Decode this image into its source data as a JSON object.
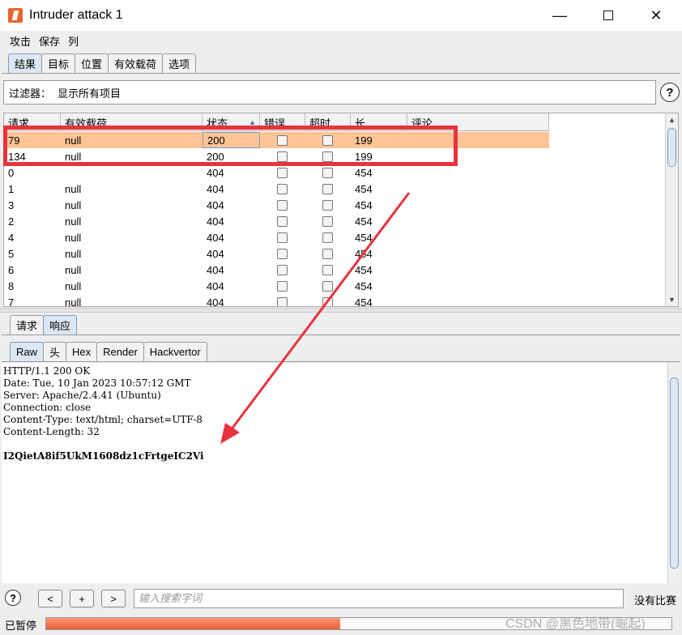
{
  "window": {
    "title": "Intruder attack 1",
    "minimize": "—",
    "close": "✕"
  },
  "menu": [
    "攻击",
    "保存",
    "列"
  ],
  "main_tabs": [
    {
      "label": "结果",
      "active": true
    },
    {
      "label": "目标",
      "active": false
    },
    {
      "label": "位置",
      "active": false
    },
    {
      "label": "有效载荷",
      "active": false
    },
    {
      "label": "选项",
      "active": false
    }
  ],
  "filter": {
    "label": "过滤器：",
    "value": "显示所有项目",
    "help": "?"
  },
  "table": {
    "columns": [
      "请求",
      "有效载荷",
      "状态",
      "错误",
      "超时",
      "长",
      "评论"
    ],
    "sort_indicator": "▲",
    "rows": [
      {
        "request": "79",
        "payload": "null",
        "status": "200",
        "error": false,
        "timeout": false,
        "length": "199",
        "comment": "",
        "selected": true
      },
      {
        "request": "134",
        "payload": "null",
        "status": "200",
        "error": false,
        "timeout": false,
        "length": "199",
        "comment": "",
        "selected": false
      },
      {
        "request": "0",
        "payload": "",
        "status": "404",
        "error": false,
        "timeout": false,
        "length": "454",
        "comment": "",
        "selected": false
      },
      {
        "request": "1",
        "payload": "null",
        "status": "404",
        "error": false,
        "timeout": false,
        "length": "454",
        "comment": "",
        "selected": false
      },
      {
        "request": "3",
        "payload": "null",
        "status": "404",
        "error": false,
        "timeout": false,
        "length": "454",
        "comment": "",
        "selected": false
      },
      {
        "request": "2",
        "payload": "null",
        "status": "404",
        "error": false,
        "timeout": false,
        "length": "454",
        "comment": "",
        "selected": false
      },
      {
        "request": "4",
        "payload": "null",
        "status": "404",
        "error": false,
        "timeout": false,
        "length": "454",
        "comment": "",
        "selected": false
      },
      {
        "request": "5",
        "payload": "null",
        "status": "404",
        "error": false,
        "timeout": false,
        "length": "454",
        "comment": "",
        "selected": false
      },
      {
        "request": "6",
        "payload": "null",
        "status": "404",
        "error": false,
        "timeout": false,
        "length": "454",
        "comment": "",
        "selected": false
      },
      {
        "request": "8",
        "payload": "null",
        "status": "404",
        "error": false,
        "timeout": false,
        "length": "454",
        "comment": "",
        "selected": false
      },
      {
        "request": "7",
        "payload": "null",
        "status": "404",
        "error": false,
        "timeout": false,
        "length": "454",
        "comment": "",
        "selected": false
      }
    ]
  },
  "detail_tabs": [
    {
      "label": "请求",
      "active": false
    },
    {
      "label": "响应",
      "active": true
    }
  ],
  "view_tabs": [
    {
      "label": "Raw",
      "active": true
    },
    {
      "label": "头",
      "active": false
    },
    {
      "label": "Hex",
      "active": false
    },
    {
      "label": "Render",
      "active": false
    },
    {
      "label": "Hackvertor",
      "active": false
    }
  ],
  "response": {
    "headers": [
      "HTTP/1.1 200 OK",
      "Date: Tue, 10 Jan 2023 10:57:12 GMT",
      "Server: Apache/2.4.41 (Ubuntu)",
      "Connection: close",
      "Content-Type: text/html; charset=UTF-8",
      "Content-Length: 32"
    ],
    "body": "I2QietA8if5UkM1608dz1cFrtgeIC2Vi"
  },
  "search": {
    "help": "?",
    "prev": "<",
    "add": "+",
    "next": ">",
    "placeholder": "输入搜索字词",
    "result": "没有比赛"
  },
  "status": {
    "text": "已暂停",
    "progress": 0.47
  },
  "watermark": "CSDN @黑色地带(崛起)",
  "colors": {
    "selected_row": "#ffc496",
    "highlight_box": "#e8323c",
    "active_tab": "#dbe7f3",
    "progress": "#f05a3a"
  },
  "icons": {
    "app": "burp-suite-icon",
    "help": "help-icon",
    "maximize": "maximize-icon"
  }
}
